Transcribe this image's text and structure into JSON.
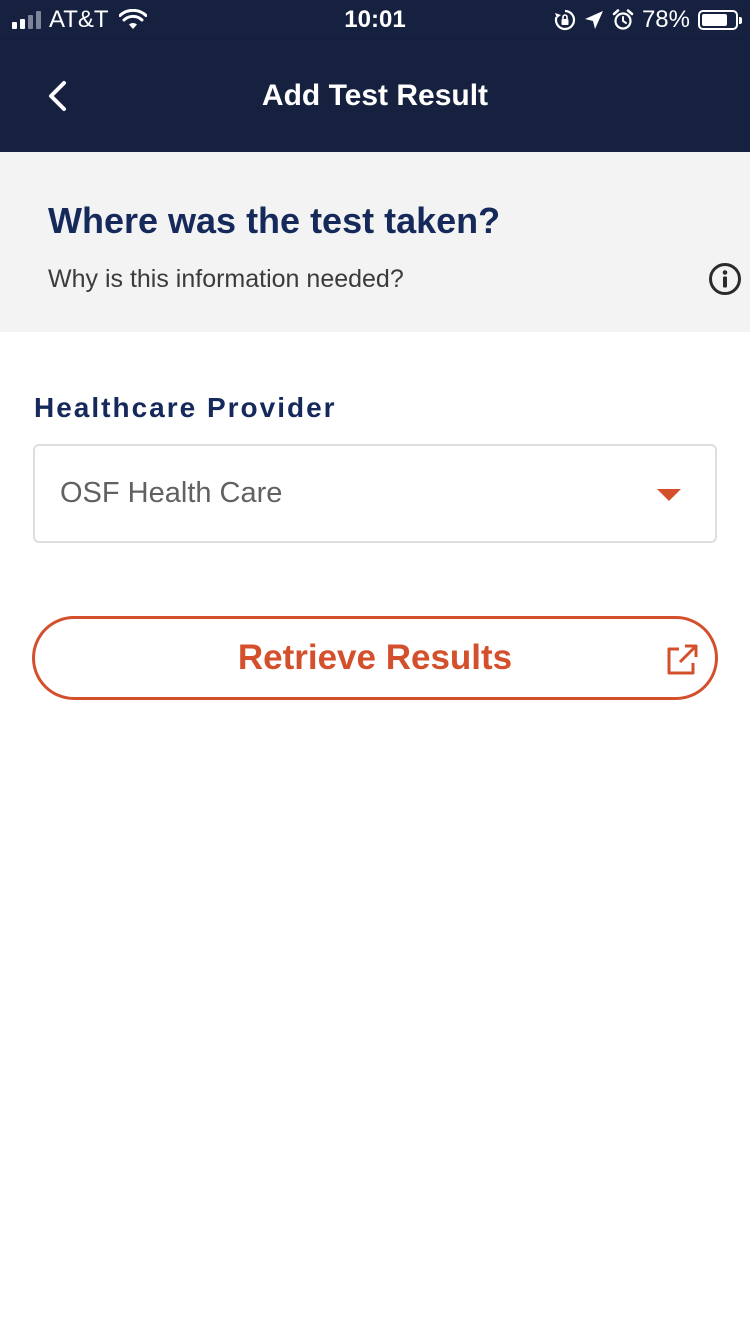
{
  "status_bar": {
    "carrier": "AT&T",
    "time": "10:01",
    "battery_percent": "78%",
    "battery_level": 0.78,
    "signal_bars": 2,
    "icons": [
      "signal-icon",
      "wifi-icon",
      "orientation-lock-icon",
      "location-icon",
      "alarm-icon",
      "battery-icon"
    ]
  },
  "nav": {
    "title": "Add Test Result",
    "back_icon": "chevron-left-icon"
  },
  "question": {
    "title": "Where was the test taken?",
    "why_text": "Why is this information needed?",
    "info_icon": "info-icon"
  },
  "form": {
    "provider_label": "Healthcare Provider",
    "provider_value": "OSF Health Care",
    "dropdown_icon": "caret-down-icon"
  },
  "actions": {
    "retrieve_label": "Retrieve Results",
    "retrieve_icon": "external-link-icon"
  },
  "colors": {
    "navy": "#15213f",
    "heading": "#15295a",
    "accent": "#d4502d",
    "panel_bg": "#f3f3f3"
  }
}
